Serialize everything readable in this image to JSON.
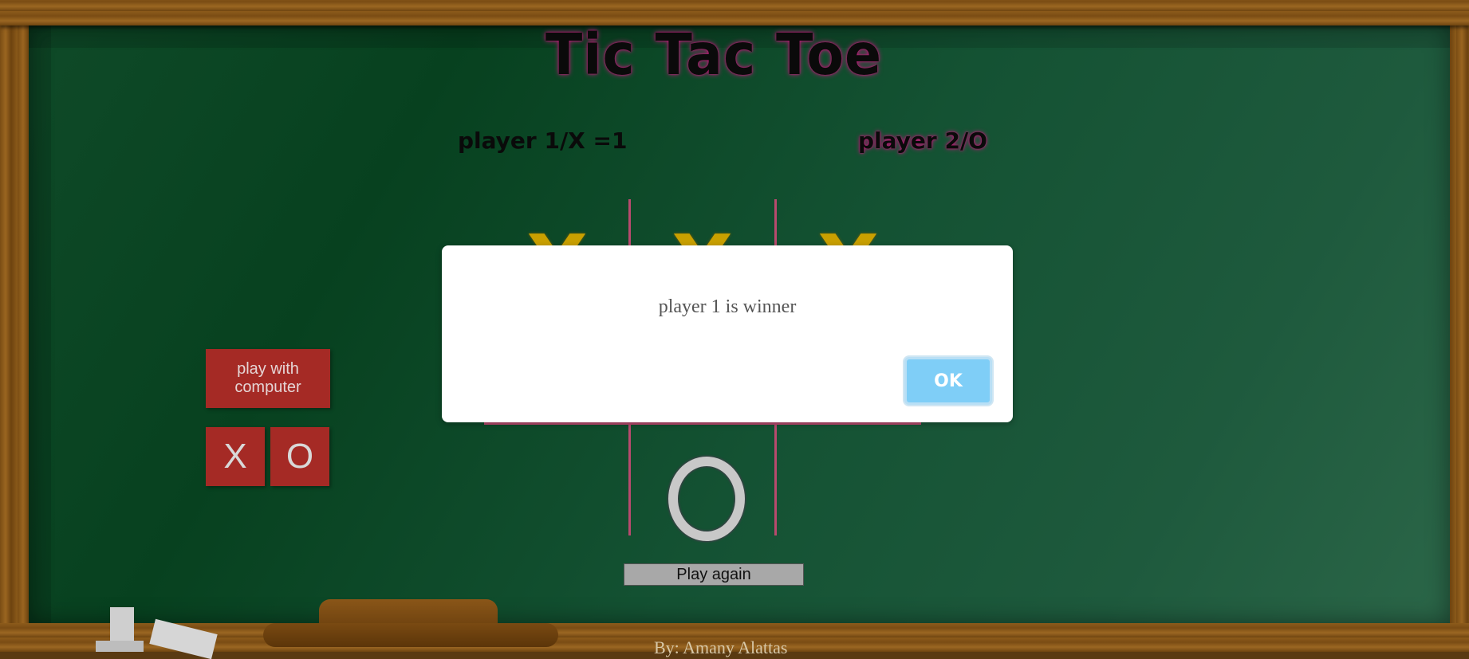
{
  "title": "Tic Tac Toe",
  "players": {
    "player1": "player 1/X =1",
    "player2": "player 2/O"
  },
  "board": {
    "cells": [
      "X",
      "X",
      "X",
      "",
      "",
      "",
      "",
      "O",
      ""
    ]
  },
  "controls": {
    "play_with_computer": "play with computer",
    "x_label": "X",
    "o_label": "O",
    "play_again": "Play again"
  },
  "dialog": {
    "message": "player 1 is winner",
    "ok_label": "OK"
  },
  "footer": {
    "credit": "By: Amany Alattas"
  },
  "colors": {
    "board_green": "#0f4a28",
    "button_red": "#a52a25",
    "x_color": "#c9a000",
    "glow_pink": "#c2187a",
    "ok_blue": "#7fcef7"
  }
}
